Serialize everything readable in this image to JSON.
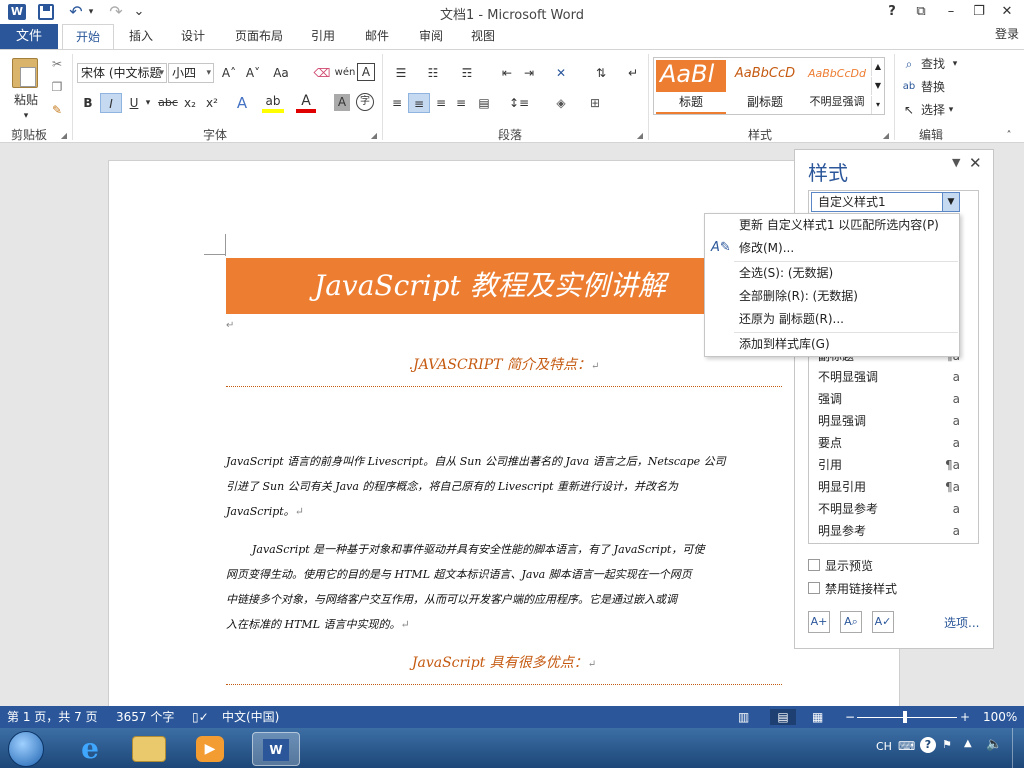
{
  "app": {
    "title": "文档1 - Microsoft Word"
  },
  "window_controls": {
    "help": "?",
    "ribbon_opts": "⧉",
    "minimize": "–",
    "maximize": "❐",
    "close": "✕"
  },
  "quick_access": {
    "undo": "↶",
    "redo": "↷",
    "more": "⌄"
  },
  "tabs": {
    "file": "文件",
    "home": "开始",
    "insert": "插入",
    "design": "设计",
    "layout": "页面布局",
    "references": "引用",
    "mailings": "邮件",
    "review": "审阅",
    "view": "视图"
  },
  "login": "登录",
  "ribbon": {
    "clipboard": {
      "paste": "粘贴",
      "group": "剪贴板"
    },
    "font": {
      "name": "宋体 (中文标题",
      "size": "小四",
      "group": "字体",
      "bold": "B",
      "italic": "I",
      "underline": "U",
      "strike": "abc",
      "sub": "x₂",
      "sup": "x²",
      "grow": "A˄",
      "shrink": "A˅",
      "case": "Aa",
      "effects": "A",
      "highlight": "ab",
      "color": "A",
      "shade": "A",
      "enclose": "字",
      "pinyin": "wén",
      "border_char": "A"
    },
    "paragraph": {
      "group": "段落"
    },
    "styles": {
      "group": "样式",
      "items": [
        "标题",
        "副标题",
        "不明显强调"
      ],
      "previews": [
        "AaBl",
        "AaBbCcD",
        "AaBbCcDd"
      ]
    },
    "editing": {
      "group": "编辑",
      "find": "查找",
      "replace": "替换",
      "select": "选择"
    }
  },
  "document": {
    "banner": "JavaScript 教程及实例讲解",
    "para_mark": "↵",
    "heading1": ".JAVASCRIPT 简介及特点：",
    "p1": [
      "JavaScript 语言的前身叫作 Livescript。自从 Sun 公司推出著名的 Java 语言之后，Netscape 公司",
      "引进了 Sun 公司有关 Java 的程序概念，将自己原有的 Livescript 重新进行设计，并改名为",
      "JavaScript。"
    ],
    "p2": [
      "JavaScript 是一种基于对象和事件驱动并具有安全性能的脚本语言，有了 JavaScript，可使",
      "网页变得生动。使用它的目的是与 HTML 超文本标识语言、Java 脚本语言一起实现在一个网页",
      "中链接多个对象，与网络客户交互作用，从而可以开发客户端的应用程序。它是通过嵌入或调",
      "入在标准的 HTML 语言中实现的。"
    ],
    "heading2": "JavaScript 具有很多优点："
  },
  "styles_pane": {
    "title": "样式",
    "selected": "自定义样式1",
    "list": [
      {
        "name": "副标题",
        "mark": "¶a"
      },
      {
        "name": "不明显强调",
        "mark": "a"
      },
      {
        "name": "强调",
        "mark": "a"
      },
      {
        "name": "明显强调",
        "mark": "a"
      },
      {
        "name": "要点",
        "mark": "a"
      },
      {
        "name": "引用",
        "mark": "¶a"
      },
      {
        "name": "明显引用",
        "mark": "¶a"
      },
      {
        "name": "不明显参考",
        "mark": "a"
      },
      {
        "name": "明显参考",
        "mark": "a"
      }
    ],
    "show_preview": "显示预览",
    "disable_linked": "禁用链接样式",
    "options": "选项..."
  },
  "context_menu": {
    "update": "更新 自定义样式1 以匹配所选内容(P)",
    "modify": "修改(M)...",
    "select_all": "全选(S): (无数据)",
    "delete_all": "全部删除(R): (无数据)",
    "revert": "还原为 副标题(R)...",
    "add_gallery": "添加到样式库(G)"
  },
  "status": {
    "page": "第 1 页，共 7 页",
    "words": "3657 个字",
    "language": "中文(中国)",
    "zoom": "100%",
    "zoom_minus": "−",
    "zoom_plus": "+"
  },
  "taskbar": {
    "ime": "CH",
    "help": "?"
  },
  "colors": {
    "word_blue": "#2b579a",
    "accent_orange": "#ed7d31",
    "heading_orange": "#c55a11"
  }
}
